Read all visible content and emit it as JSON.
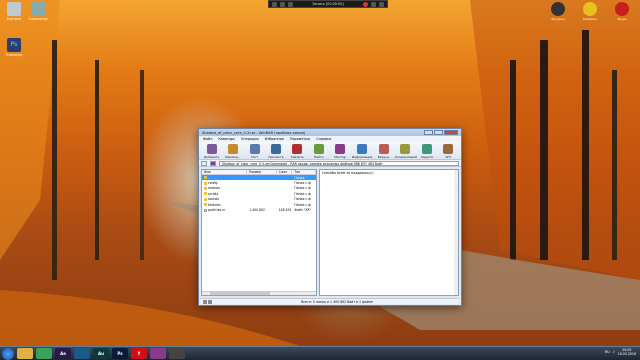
{
  "desktop": {
    "left_icons": [
      {
        "label": "Корзина",
        "icon": "recycle-bin-icon",
        "color": "#c0c8d0"
      },
      {
        "label": "Photoshop",
        "icon": "photoshop-icon",
        "color": "#2d3e6e"
      },
      {
        "label": "Компьютер",
        "icon": "computer-icon",
        "color": "#8aa"
      }
    ],
    "right_icons": [
      {
        "label": "Ресурсы",
        "icon": "resources-icon",
        "color": "#333"
      },
      {
        "label": "Radiation",
        "icon": "radiation-icon",
        "color": "#e8c020"
      },
      {
        "label": "Skype",
        "icon": "skype-icon",
        "color": "#c81e1e"
      }
    ]
  },
  "recorder": {
    "time": "Запись [00:00:00]"
  },
  "window": {
    "title": "Shadow_of_color_core_0.3.rar - WinRAR (пробная копия)",
    "menu": [
      "Файл",
      "Команды",
      "Операции",
      "Избранное",
      "Параметры",
      "Справка"
    ],
    "toolbar": [
      {
        "label": "Добавить",
        "icon": "add-icon",
        "color": "#7a5a9a"
      },
      {
        "label": "Извлечь...",
        "icon": "extract-icon",
        "color": "#c58a2a"
      },
      {
        "label": "Тест",
        "icon": "test-icon",
        "color": "#5a7ab0"
      },
      {
        "label": "Просмотр",
        "icon": "view-icon",
        "color": "#3a6a9a"
      },
      {
        "label": "Удалить",
        "icon": "delete-icon",
        "color": "#b03030"
      },
      {
        "label": "Найти",
        "icon": "find-icon",
        "color": "#6a9a3a"
      },
      {
        "label": "Мастер",
        "icon": "wizard-icon",
        "color": "#8a3a8a"
      },
      {
        "label": "Информация",
        "icon": "info-icon",
        "color": "#3a7ac0"
      },
      {
        "label": "Вирусы",
        "icon": "virus-icon",
        "color": "#c05a5a"
      },
      {
        "label": "Комментарий",
        "icon": "comment-icon",
        "color": "#9a9a3a"
      },
      {
        "label": "Защита",
        "icon": "protect-icon",
        "color": "#3a9a7a"
      },
      {
        "label": "SFX",
        "icon": "sfx-icon",
        "color": "#9a6a3a"
      }
    ],
    "path": "Shadow_of_color_core_0.3.rar\\Gamedata - RAR архив, размер исходных файлов 588 837 483 байт",
    "columns": [
      "Имя",
      "Размер",
      "Сжат",
      "Тип"
    ],
    "files": [
      {
        "name": "..",
        "size": "",
        "packed": "",
        "type": "Папка"
      },
      {
        "name": "config",
        "size": "",
        "packed": "",
        "type": "Папка с ф"
      },
      {
        "name": "meshes",
        "size": "",
        "packed": "",
        "type": "Папка с ф"
      },
      {
        "name": "scripts",
        "size": "",
        "packed": "",
        "type": "Папка с ф"
      },
      {
        "name": "sounds",
        "size": "",
        "packed": "",
        "type": "Папка с ф"
      },
      {
        "name": "textures",
        "size": "",
        "packed": "",
        "type": "Папка с ф"
      },
      {
        "name": "particles.xr",
        "size": "1 400 892",
        "packed": "148 592",
        "type": "Файл \"XR\""
      }
    ],
    "comment": "спасибо всем за поддержку!)",
    "status": "Всего: 5 папок и 1 400 892 байт в 1 файле"
  },
  "taskbar": {
    "apps": [
      {
        "label": "",
        "icon": "explorer-icon",
        "color": "#e0b040"
      },
      {
        "label": "",
        "icon": "chrome-icon",
        "color": "#3aa35a"
      },
      {
        "label": "Ae",
        "icon": "after-effects-icon",
        "color": "#2a1a4a"
      },
      {
        "label": "",
        "icon": "media-icon",
        "color": "#1a5a8a"
      },
      {
        "label": "Au",
        "icon": "audition-icon",
        "color": "#0a3a3a"
      },
      {
        "label": "Ps",
        "icon": "photoshop-icon",
        "color": "#0a1a3a"
      },
      {
        "label": "Y",
        "icon": "yandex-icon",
        "color": "#d01010"
      },
      {
        "label": "",
        "icon": "winrar-icon",
        "color": "#8a3a8a"
      },
      {
        "label": "",
        "icon": "recorder-icon",
        "color": "#444444"
      }
    ],
    "lang": "RU",
    "time": "20:05",
    "date": "18.05.2016"
  }
}
